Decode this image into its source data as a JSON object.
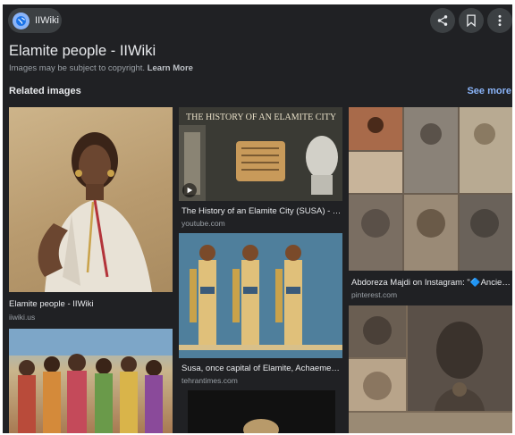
{
  "header": {
    "site_chip_label": "IIWiki",
    "title": "Elamite people - IIWiki",
    "copyright_text": "Images may be subject to copyright.",
    "learn_more": "Learn More"
  },
  "related": {
    "heading": "Related images",
    "see_more": "See more"
  },
  "results": [
    {
      "title": "Elamite people - IIWiki",
      "source": "iiwiki.us"
    },
    {
      "title": "The History of an Elamite City (SUSA) - Y...",
      "source": "youtube.com",
      "overlay_text": "THE HISTORY OF AN ELAMITE CITY"
    },
    {
      "title": "Abdoreza Majdi on Instagram: \"🔷Ancient...",
      "source": "pinterest.com"
    },
    {
      "title": "Susa, once capital of Elamite, Achaemeni...",
      "source": "tehrantimes.com"
    }
  ],
  "icons": {
    "site": "globe-icon",
    "share": "share-icon",
    "save": "bookmark-icon",
    "more": "more-vert-icon",
    "video": "play-icon"
  },
  "colors": {
    "background": "#202124",
    "accent": "#8ab4f8",
    "text": "#e8eaed",
    "muted": "#9aa0a6"
  }
}
